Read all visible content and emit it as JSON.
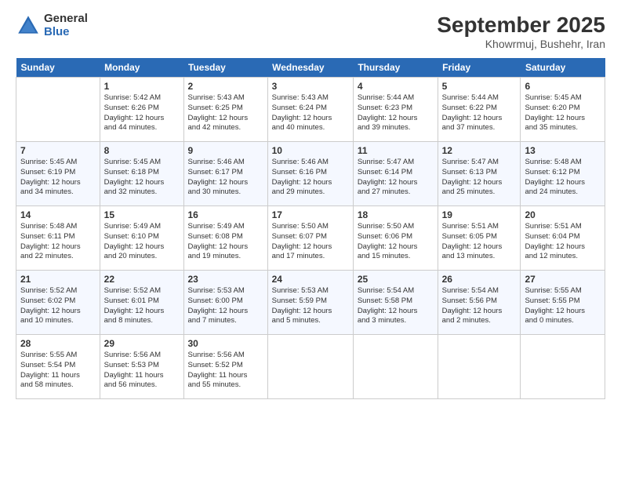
{
  "logo": {
    "general": "General",
    "blue": "Blue"
  },
  "header": {
    "month": "September 2025",
    "location": "Khowrmuj, Bushehr, Iran"
  },
  "days_of_week": [
    "Sunday",
    "Monday",
    "Tuesday",
    "Wednesday",
    "Thursday",
    "Friday",
    "Saturday"
  ],
  "weeks": [
    [
      {
        "day": "",
        "info": ""
      },
      {
        "day": "1",
        "info": "Sunrise: 5:42 AM\nSunset: 6:26 PM\nDaylight: 12 hours\nand 44 minutes."
      },
      {
        "day": "2",
        "info": "Sunrise: 5:43 AM\nSunset: 6:25 PM\nDaylight: 12 hours\nand 42 minutes."
      },
      {
        "day": "3",
        "info": "Sunrise: 5:43 AM\nSunset: 6:24 PM\nDaylight: 12 hours\nand 40 minutes."
      },
      {
        "day": "4",
        "info": "Sunrise: 5:44 AM\nSunset: 6:23 PM\nDaylight: 12 hours\nand 39 minutes."
      },
      {
        "day": "5",
        "info": "Sunrise: 5:44 AM\nSunset: 6:22 PM\nDaylight: 12 hours\nand 37 minutes."
      },
      {
        "day": "6",
        "info": "Sunrise: 5:45 AM\nSunset: 6:20 PM\nDaylight: 12 hours\nand 35 minutes."
      }
    ],
    [
      {
        "day": "7",
        "info": "Sunrise: 5:45 AM\nSunset: 6:19 PM\nDaylight: 12 hours\nand 34 minutes."
      },
      {
        "day": "8",
        "info": "Sunrise: 5:45 AM\nSunset: 6:18 PM\nDaylight: 12 hours\nand 32 minutes."
      },
      {
        "day": "9",
        "info": "Sunrise: 5:46 AM\nSunset: 6:17 PM\nDaylight: 12 hours\nand 30 minutes."
      },
      {
        "day": "10",
        "info": "Sunrise: 5:46 AM\nSunset: 6:16 PM\nDaylight: 12 hours\nand 29 minutes."
      },
      {
        "day": "11",
        "info": "Sunrise: 5:47 AM\nSunset: 6:14 PM\nDaylight: 12 hours\nand 27 minutes."
      },
      {
        "day": "12",
        "info": "Sunrise: 5:47 AM\nSunset: 6:13 PM\nDaylight: 12 hours\nand 25 minutes."
      },
      {
        "day": "13",
        "info": "Sunrise: 5:48 AM\nSunset: 6:12 PM\nDaylight: 12 hours\nand 24 minutes."
      }
    ],
    [
      {
        "day": "14",
        "info": "Sunrise: 5:48 AM\nSunset: 6:11 PM\nDaylight: 12 hours\nand 22 minutes."
      },
      {
        "day": "15",
        "info": "Sunrise: 5:49 AM\nSunset: 6:10 PM\nDaylight: 12 hours\nand 20 minutes."
      },
      {
        "day": "16",
        "info": "Sunrise: 5:49 AM\nSunset: 6:08 PM\nDaylight: 12 hours\nand 19 minutes."
      },
      {
        "day": "17",
        "info": "Sunrise: 5:50 AM\nSunset: 6:07 PM\nDaylight: 12 hours\nand 17 minutes."
      },
      {
        "day": "18",
        "info": "Sunrise: 5:50 AM\nSunset: 6:06 PM\nDaylight: 12 hours\nand 15 minutes."
      },
      {
        "day": "19",
        "info": "Sunrise: 5:51 AM\nSunset: 6:05 PM\nDaylight: 12 hours\nand 13 minutes."
      },
      {
        "day": "20",
        "info": "Sunrise: 5:51 AM\nSunset: 6:04 PM\nDaylight: 12 hours\nand 12 minutes."
      }
    ],
    [
      {
        "day": "21",
        "info": "Sunrise: 5:52 AM\nSunset: 6:02 PM\nDaylight: 12 hours\nand 10 minutes."
      },
      {
        "day": "22",
        "info": "Sunrise: 5:52 AM\nSunset: 6:01 PM\nDaylight: 12 hours\nand 8 minutes."
      },
      {
        "day": "23",
        "info": "Sunrise: 5:53 AM\nSunset: 6:00 PM\nDaylight: 12 hours\nand 7 minutes."
      },
      {
        "day": "24",
        "info": "Sunrise: 5:53 AM\nSunset: 5:59 PM\nDaylight: 12 hours\nand 5 minutes."
      },
      {
        "day": "25",
        "info": "Sunrise: 5:54 AM\nSunset: 5:58 PM\nDaylight: 12 hours\nand 3 minutes."
      },
      {
        "day": "26",
        "info": "Sunrise: 5:54 AM\nSunset: 5:56 PM\nDaylight: 12 hours\nand 2 minutes."
      },
      {
        "day": "27",
        "info": "Sunrise: 5:55 AM\nSunset: 5:55 PM\nDaylight: 12 hours\nand 0 minutes."
      }
    ],
    [
      {
        "day": "28",
        "info": "Sunrise: 5:55 AM\nSunset: 5:54 PM\nDaylight: 11 hours\nand 58 minutes."
      },
      {
        "day": "29",
        "info": "Sunrise: 5:56 AM\nSunset: 5:53 PM\nDaylight: 11 hours\nand 56 minutes."
      },
      {
        "day": "30",
        "info": "Sunrise: 5:56 AM\nSunset: 5:52 PM\nDaylight: 11 hours\nand 55 minutes."
      },
      {
        "day": "",
        "info": ""
      },
      {
        "day": "",
        "info": ""
      },
      {
        "day": "",
        "info": ""
      },
      {
        "day": "",
        "info": ""
      }
    ]
  ]
}
